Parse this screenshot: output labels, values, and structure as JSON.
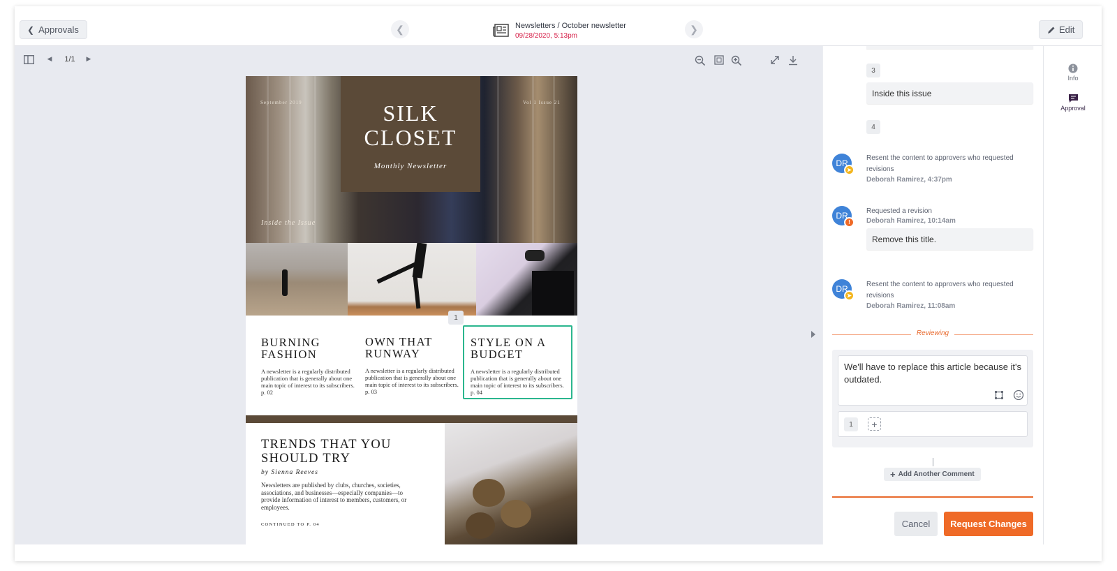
{
  "header": {
    "back_label": "Approvals",
    "breadcrumb": "Newsletters / October newsletter",
    "date": "09/28/2020, 5:13pm",
    "edit_label": "Edit"
  },
  "viewer": {
    "page_indicator": "1/1"
  },
  "newsletter": {
    "date_label": "September 2019",
    "issue_label": "Vol 1 Issue 21",
    "title_line1": "SILK",
    "title_line2": "CLOSET",
    "subtitle": "Monthly Newsletter",
    "inside": "Inside the Issue",
    "annotation_pin": "1",
    "articles": [
      {
        "title": "BURNING FASHION",
        "body": "A newsletter is a regularly distributed publication that is generally about one main topic of interest to its subscribers. p. 02"
      },
      {
        "title": "OWN THAT RUNWAY",
        "body": "A newsletter is a regularly distributed publication that is generally about one main topic of interest to its subscribers. p. 03"
      },
      {
        "title": "STYLE ON A BUDGET",
        "body": "A newsletter is a regularly distributed publication that is generally about one main topic of interest to its subscribers. p. 04"
      }
    ],
    "feature": {
      "title": "TRENDS THAT YOU SHOULD TRY",
      "byline": "by Sienna Reeves",
      "body": "Newsletters are published by clubs, churches, societies, associations, and businesses—especially companies—to provide information of interest to members, customers, or employees.",
      "continued": "CONTINUED TO P. 04"
    }
  },
  "panel": {
    "items": [
      {
        "num": "3",
        "text": "Inside this issue"
      },
      {
        "num": "4"
      }
    ],
    "activity": [
      {
        "initials": "DR",
        "text": "Resent the content to approvers who requested revisions",
        "meta": "Deborah Ramirez, 4:37pm",
        "badge_color": "#f3b51d"
      },
      {
        "initials": "DR",
        "text": "Requested a revision",
        "meta": "Deborah Ramirez, 10:14am",
        "comment": "Remove this title.",
        "badge_color": "#ef6a27"
      },
      {
        "initials": "DR",
        "text": "Resent the content to approvers who requested revisions",
        "meta": "Deborah Ramirez, 11:08am",
        "badge_color": "#f3b51d"
      }
    ],
    "reviewing_label": "Reviewing",
    "comment_text": "We'll have to replace this article because it's outdated.",
    "comment_pin": "1",
    "add_comment_label": "Add Another Comment",
    "cancel_label": "Cancel",
    "request_label": "Request Changes"
  },
  "rail": {
    "info_label": "Info",
    "approval_label": "Approval"
  },
  "colors": {
    "accent": "#ef6a27",
    "highlight": "#2bb68e",
    "date_red": "#d6214a",
    "avatar_blue": "#3f83d8"
  }
}
